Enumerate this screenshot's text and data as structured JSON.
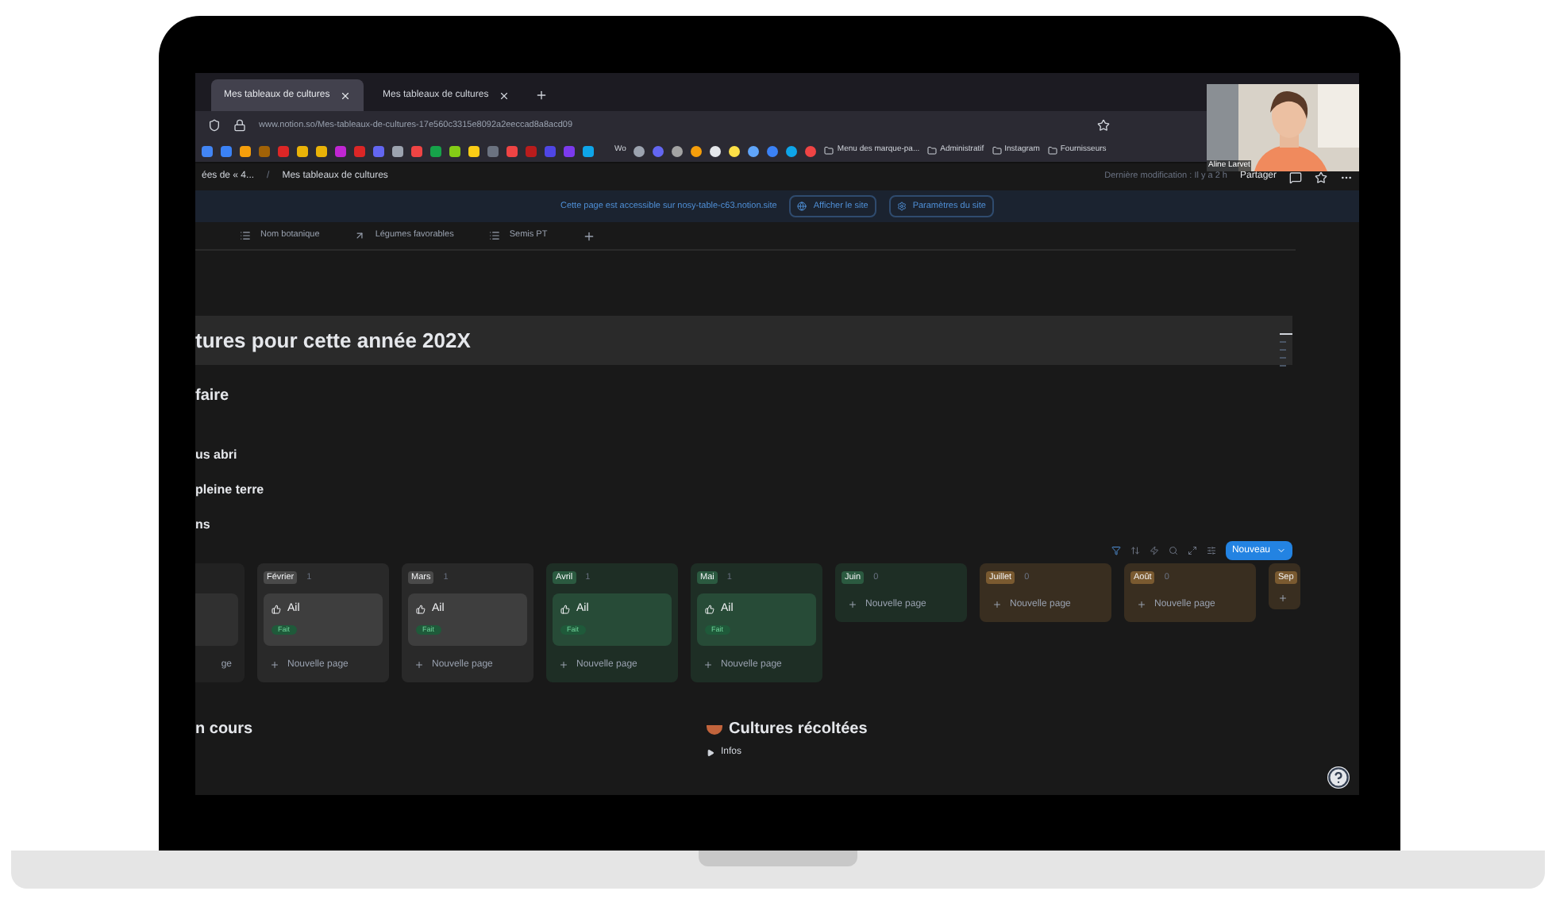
{
  "browser": {
    "tabs": [
      {
        "title": "Mes tableaux de cultures",
        "selected": true
      },
      {
        "title": "Mes tableaux de cultures",
        "selected": false
      }
    ],
    "url": "www.notion.so/Mes-tableaux-de-cultures-17e560c3315e8092a2eeccad8a8acd09",
    "bookmarks": [
      {
        "label": "Wo"
      },
      {
        "label": "Menu des marque-pa..."
      },
      {
        "label": "Administratif"
      },
      {
        "label": "Instagram"
      },
      {
        "label": "Fournisseurs"
      }
    ]
  },
  "webcam": {
    "name": "Aline Larvet"
  },
  "topbar": {
    "breadcrumb": [
      "ées de « 4...",
      "Mes tableaux de cultures"
    ],
    "separator": "/",
    "edited": "Dernière modification : Il y a 2 h",
    "share": "Partager"
  },
  "banner": {
    "text": "Cette page est accessible sur nosy-table-c63.notion.site",
    "buttons": [
      "Afficher le site",
      "Paramètres du site"
    ]
  },
  "views": [
    "Nom botanique",
    "Légumes favorables",
    "Semis PT"
  ],
  "heading": "tures pour cette année 202X",
  "sections": [
    {
      "text": "faire",
      "kind": "title"
    },
    {
      "text": "us abri",
      "kind": "sub"
    },
    {
      "text": "pleine terre",
      "kind": "sub"
    },
    {
      "text": "ns",
      "kind": "sub"
    }
  ],
  "board": {
    "new_button": "Nouveau",
    "columns": [
      {
        "color": "#373737",
        "cards": [
          {
            "kind": "blank"
          }
        ],
        "new_page": "ge"
      },
      {
        "label": "Février",
        "count": "1",
        "color": "#4a4a4a",
        "cards": [
          {
            "title": "Ail",
            "tag": "Fait"
          }
        ],
        "new_page": "Nouvelle page"
      },
      {
        "label": "Mars",
        "count": "1",
        "color": "#4a4a4a",
        "cards": [
          {
            "title": "Ail",
            "tag": "Fait"
          }
        ],
        "new_page": "Nouvelle page"
      },
      {
        "label": "Avril",
        "count": "1",
        "color": "#2b5a40",
        "cards": [
          {
            "title": "Ail",
            "tag": "Fait"
          }
        ],
        "new_page": "Nouvelle page"
      },
      {
        "label": "Mai",
        "count": "1",
        "color": "#2b5a40",
        "cards": [
          {
            "title": "Ail",
            "tag": "Fait"
          }
        ],
        "new_page": "Nouvelle page"
      },
      {
        "label": "Juin",
        "count": "0",
        "color": "#2b5a40",
        "new_page": "Nouvelle page"
      },
      {
        "label": "Juillet",
        "count": "0",
        "color": "#7a5a30",
        "new_page": "Nouvelle page"
      },
      {
        "label": "Août",
        "count": "0",
        "color": "#7a5a30",
        "new_page": "Nouvelle page"
      },
      {
        "label": "Sep",
        "color": "#7a5a30"
      }
    ]
  },
  "bottom": {
    "left_title": "n cours",
    "right_title": "Cultures récoltées",
    "toggle": "Infos"
  }
}
